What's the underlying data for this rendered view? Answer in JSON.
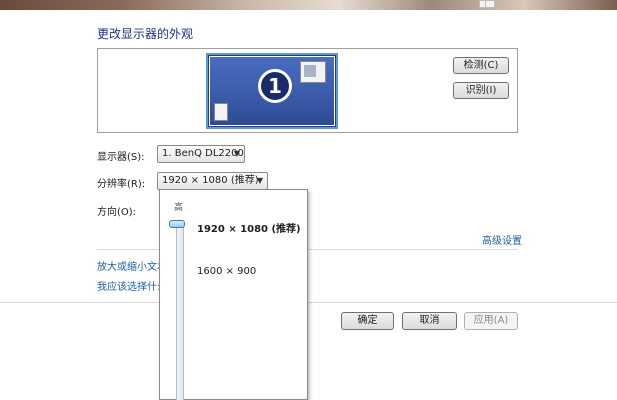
{
  "title": "更改显示器的外观",
  "monitor": {
    "number": "1"
  },
  "buttons": {
    "detect": "检测(C)",
    "identify": "识别(I)",
    "ok": "确定",
    "cancel": "取消",
    "apply": "应用(A)"
  },
  "fields": {
    "display_label": "显示器(S):",
    "display_value": "1. BenQ DL2200",
    "resolution_label": "分辨率(R):",
    "resolution_value": "1920 × 1080 (推荐)",
    "orientation_label": "方向(O):"
  },
  "links": {
    "advanced": "高级设置",
    "text_size": "放大或缩小文本",
    "which_setting": "我应该选择什么"
  },
  "resolution_popup": {
    "high_label": "高",
    "options": [
      "1920 × 1080 (推荐)",
      "1600 × 900"
    ],
    "selected": "1920 × 1080 (推荐)"
  },
  "icons": {
    "dropdown_arrow": "chevron-down-icon",
    "slider_thumb": "slider-thumb-icon"
  }
}
